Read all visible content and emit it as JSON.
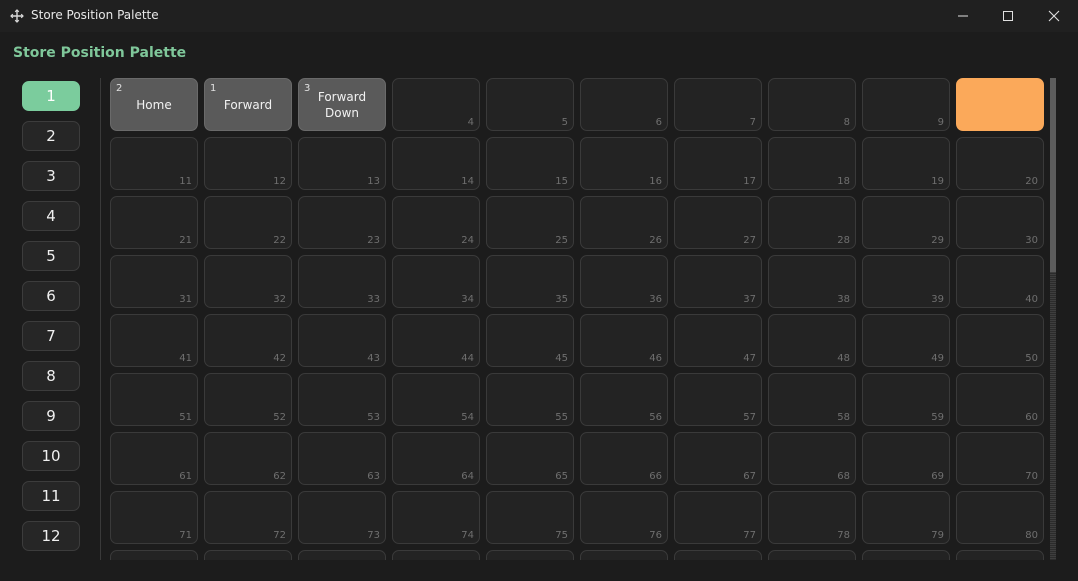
{
  "window": {
    "title": "Store Position Palette"
  },
  "heading": "Store Position Palette",
  "sidebar": {
    "items": [
      "1",
      "2",
      "3",
      "4",
      "5",
      "6",
      "7",
      "8",
      "9",
      "10",
      "11",
      "12"
    ],
    "active": "1"
  },
  "grid": {
    "cells": [
      {
        "label": "Home",
        "prefix": "2"
      },
      {
        "label": "Forward",
        "prefix": "1"
      },
      {
        "label": "Forward\nDown",
        "prefix": "3"
      },
      {
        "number": "4"
      },
      {
        "number": "5"
      },
      {
        "number": "6"
      },
      {
        "number": "7"
      },
      {
        "number": "8"
      },
      {
        "number": "9"
      },
      {
        "selected": true
      },
      {
        "number": "11"
      },
      {
        "number": "12"
      },
      {
        "number": "13"
      },
      {
        "number": "14"
      },
      {
        "number": "15"
      },
      {
        "number": "16"
      },
      {
        "number": "17"
      },
      {
        "number": "18"
      },
      {
        "number": "19"
      },
      {
        "number": "20"
      },
      {
        "number": "21"
      },
      {
        "number": "22"
      },
      {
        "number": "23"
      },
      {
        "number": "24"
      },
      {
        "number": "25"
      },
      {
        "number": "26"
      },
      {
        "number": "27"
      },
      {
        "number": "28"
      },
      {
        "number": "29"
      },
      {
        "number": "30"
      },
      {
        "number": "31"
      },
      {
        "number": "32"
      },
      {
        "number": "33"
      },
      {
        "number": "34"
      },
      {
        "number": "35"
      },
      {
        "number": "36"
      },
      {
        "number": "37"
      },
      {
        "number": "38"
      },
      {
        "number": "39"
      },
      {
        "number": "40"
      },
      {
        "number": "41"
      },
      {
        "number": "42"
      },
      {
        "number": "43"
      },
      {
        "number": "44"
      },
      {
        "number": "45"
      },
      {
        "number": "46"
      },
      {
        "number": "47"
      },
      {
        "number": "48"
      },
      {
        "number": "49"
      },
      {
        "number": "50"
      },
      {
        "number": "51"
      },
      {
        "number": "52"
      },
      {
        "number": "53"
      },
      {
        "number": "54"
      },
      {
        "number": "55"
      },
      {
        "number": "56"
      },
      {
        "number": "57"
      },
      {
        "number": "58"
      },
      {
        "number": "59"
      },
      {
        "number": "60"
      },
      {
        "number": "61"
      },
      {
        "number": "62"
      },
      {
        "number": "63"
      },
      {
        "number": "64"
      },
      {
        "number": "65"
      },
      {
        "number": "66"
      },
      {
        "number": "67"
      },
      {
        "number": "68"
      },
      {
        "number": "69"
      },
      {
        "number": "70"
      },
      {
        "number": "71"
      },
      {
        "number": "72"
      },
      {
        "number": "73"
      },
      {
        "number": "74"
      },
      {
        "number": "75"
      },
      {
        "number": "76"
      },
      {
        "number": "77"
      },
      {
        "number": "78"
      },
      {
        "number": "79"
      },
      {
        "number": "80"
      },
      {},
      {},
      {},
      {},
      {},
      {},
      {},
      {},
      {},
      {}
    ]
  },
  "colors": {
    "accent_green": "#7bcc9d",
    "selected_orange": "#fba95a",
    "stored_gray": "#5a5a5a"
  },
  "icons": {
    "app": "move-arrows-icon",
    "minimize": "minimize-icon",
    "maximize": "maximize-icon",
    "close": "close-icon"
  }
}
